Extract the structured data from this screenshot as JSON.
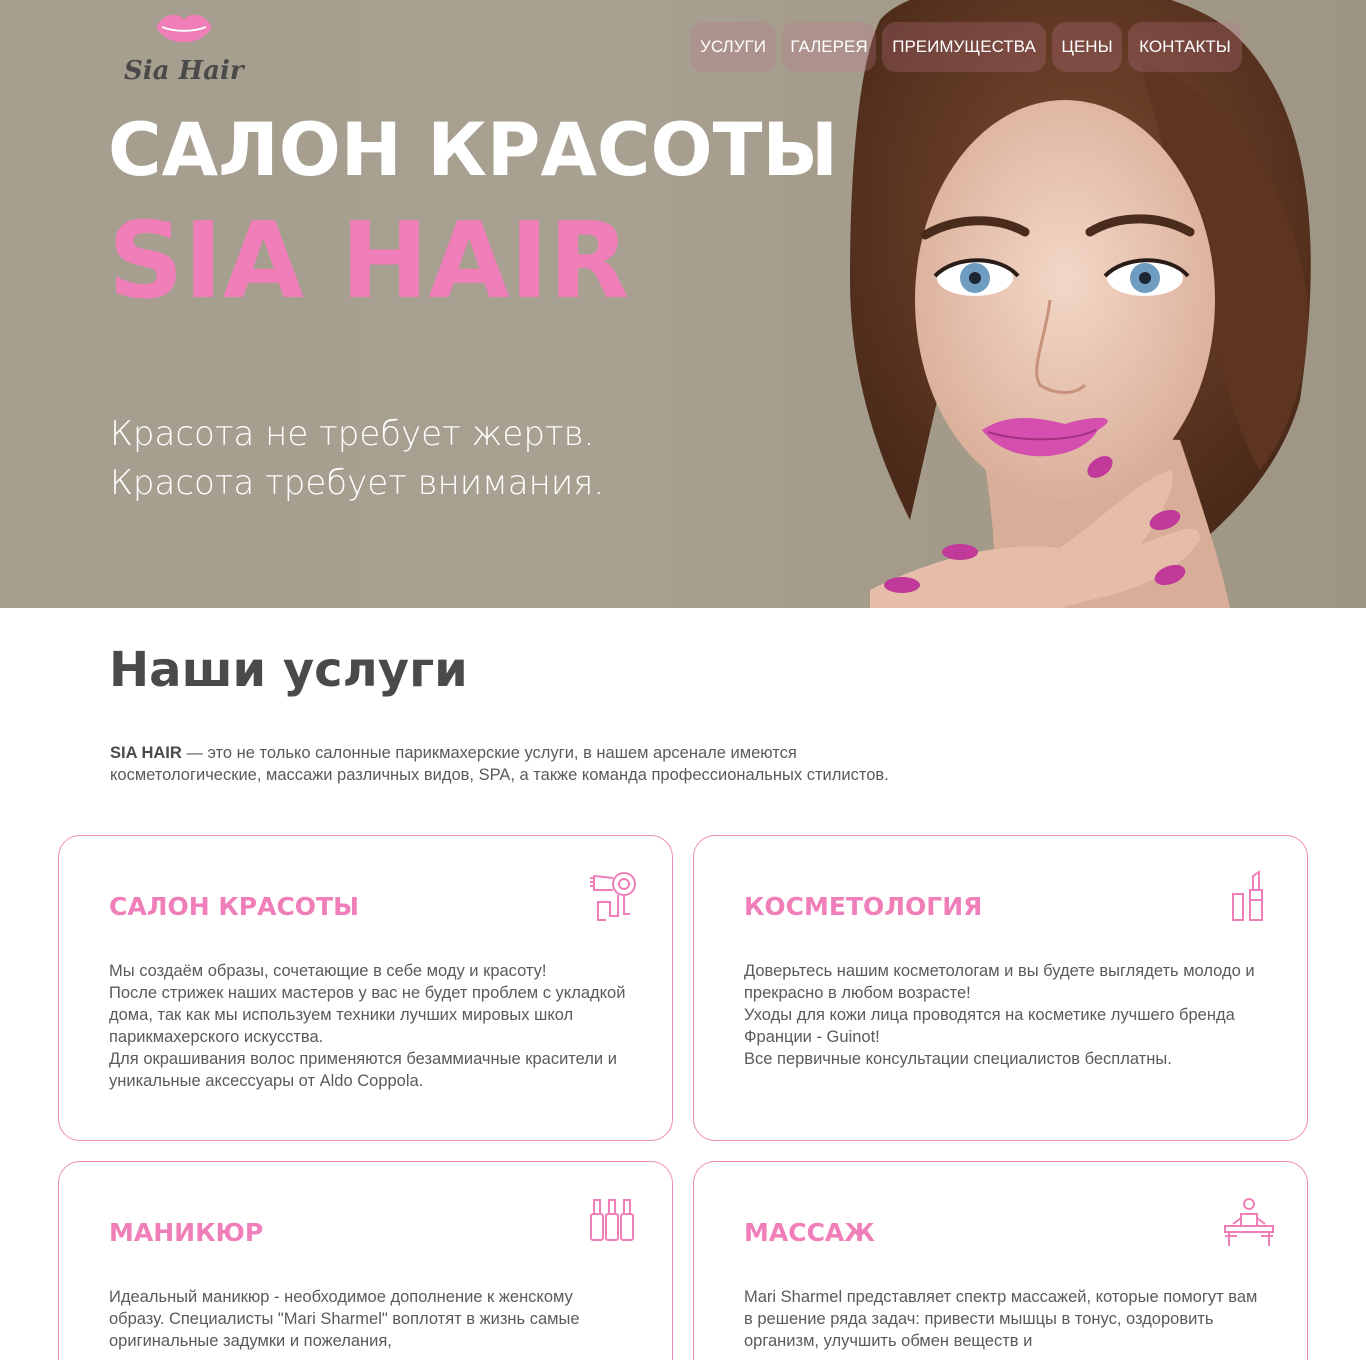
{
  "brand": {
    "logo_text": "Sia Hair",
    "accent_color": "#f07eb8",
    "text_color": "#4a4a4a"
  },
  "nav": {
    "items": [
      {
        "label": "УСЛУГИ"
      },
      {
        "label": "ГАЛЕРЕЯ"
      },
      {
        "label": "ПРЕИМУЩЕСТВА"
      },
      {
        "label": "ЦЕНЫ"
      },
      {
        "label": "КОНТАКТЫ"
      }
    ]
  },
  "hero": {
    "title_line1": "САЛОН КРАСОТЫ",
    "title_line2": "SIA HAIR",
    "tagline_line1": "Красота не требует жертв.",
    "tagline_line2": "Красота требует внимания."
  },
  "services": {
    "title": "Наши услуги",
    "intro_brand": "SIA HAIR",
    "intro_text": " — это не только салонные парикмахерские услуги, в нашем арсенале имеются косметологические, массажи различных видов, SPA, а также команда профессиональных стилистов.",
    "cards": [
      {
        "title": "САЛОН КРАСОТЫ",
        "icon": "hair-dryer-icon",
        "text": "Мы создаём образы, сочетающие в себе моду и красоту!\nПосле стрижек наших мастеров у вас не будет проблем с укладкой дома, так как мы используем техники лучших мировых школ парикмахерского искусства.\nДля окрашивания волос применяются безаммиачные красители и уникальные аксессуары от Aldo Coppola."
      },
      {
        "title": "КОСМЕТОЛОГИЯ",
        "icon": "lipstick-icon",
        "text": "Доверьтесь нашим косметологам и вы будете выглядеть молодо и прекрасно в любом возрасте!\nУходы для кожи лица проводятся на косметике лучшего бренда Франции - Guinot!\nВсе первичные консультации специалистов бесплатны."
      },
      {
        "title": "МАНИКЮР",
        "icon": "nail-polish-icon",
        "text": "Идеальный маникюр - необходимое дополнение к женскому образу. Специалисты \"Mari Sharmel\" воплотят в жизнь самые оригинальные задумки и пожелания,"
      },
      {
        "title": "МАССАЖ",
        "icon": "massage-icon",
        "text": "Mari Sharmel представляет спектр массажей, которые помогут вам в решение ряда задач: привести мышцы в тонус, оздоровить организм, улучшить обмен веществ и"
      }
    ]
  }
}
